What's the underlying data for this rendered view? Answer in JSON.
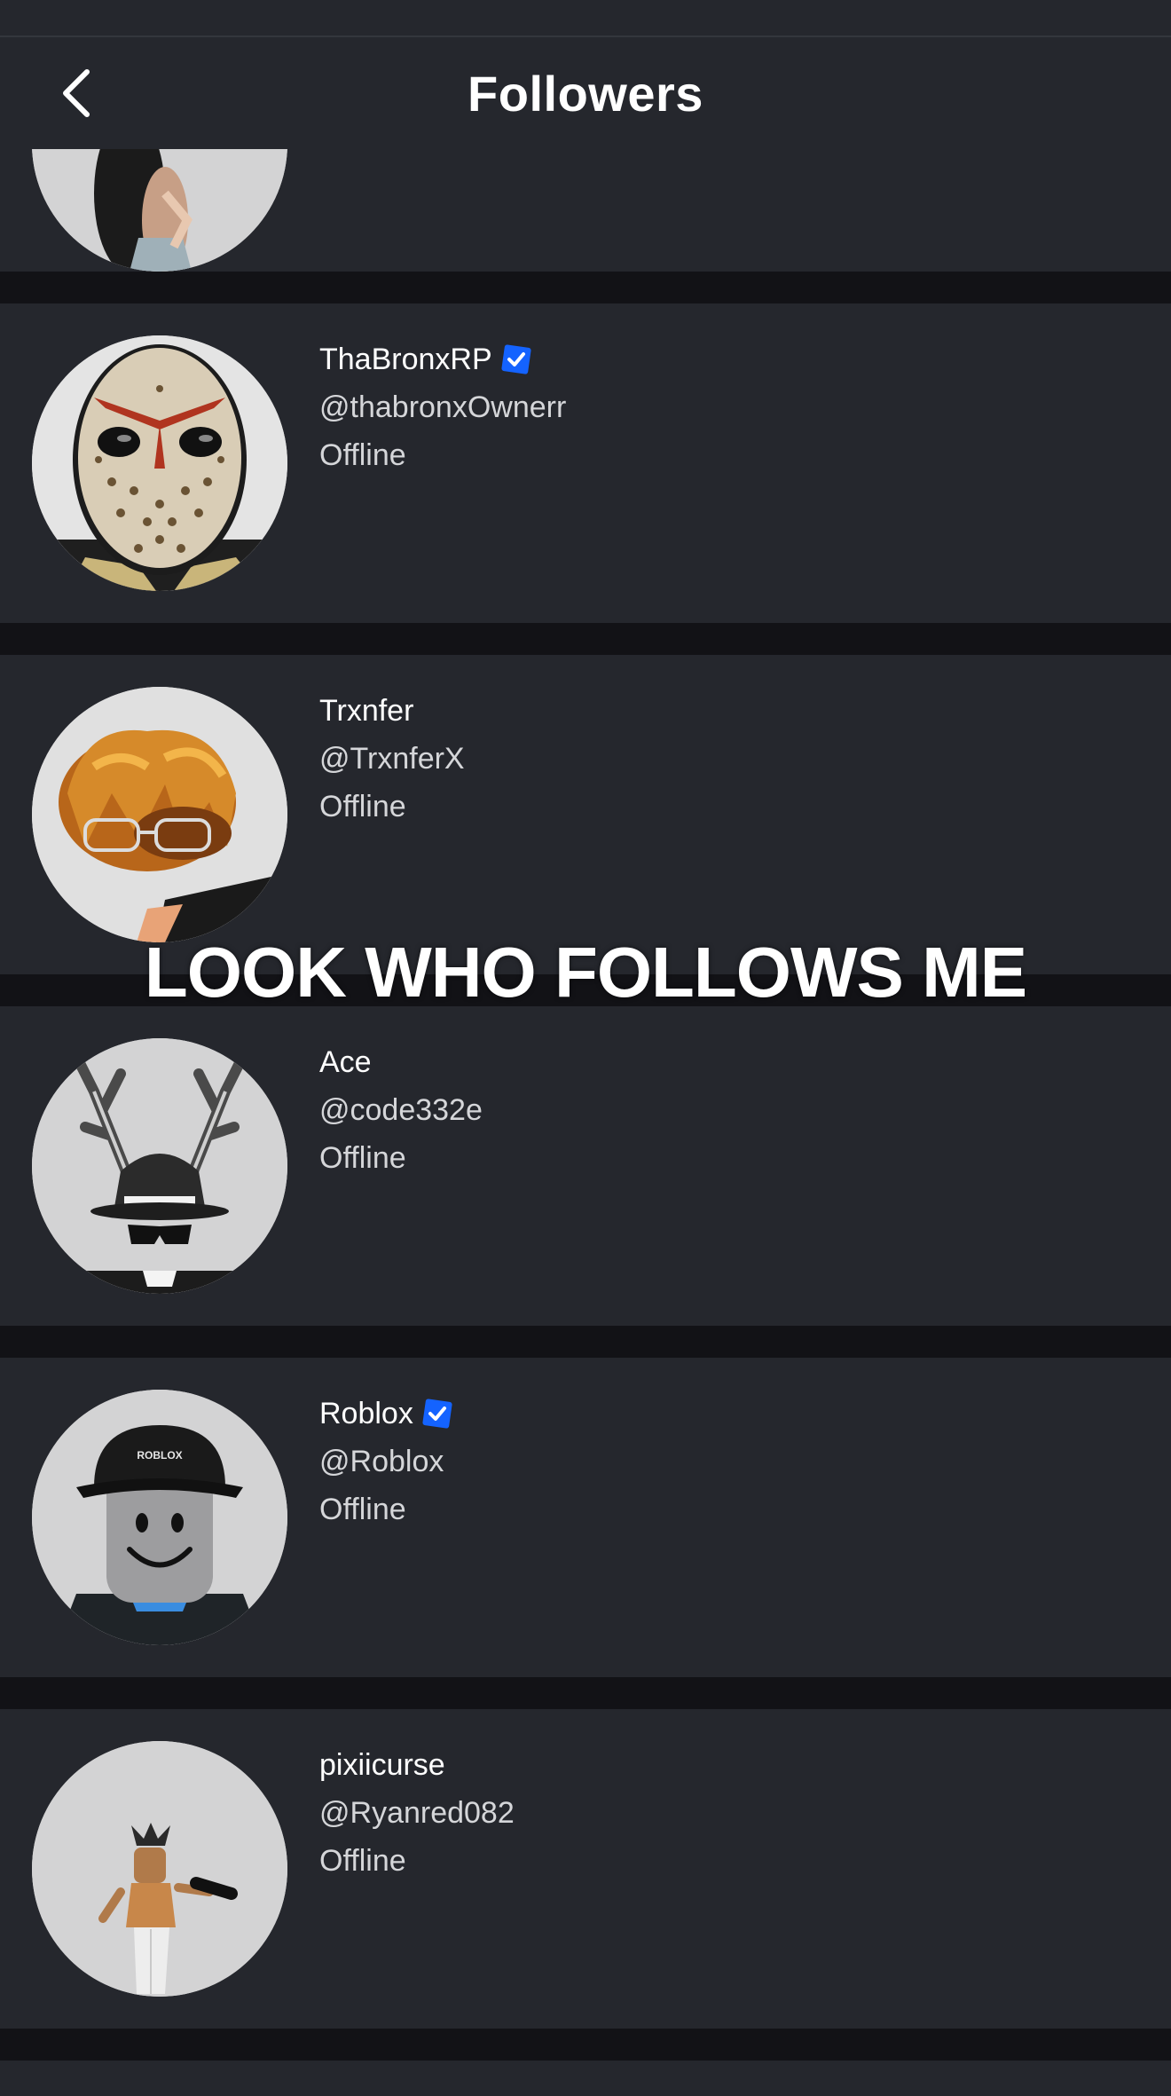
{
  "header": {
    "title": "Followers",
    "back_icon": "chevron-left-icon"
  },
  "overlay_text": "LOOK WHO FOLLOWS ME",
  "colors": {
    "card_bg": "#25272d",
    "divider": "#121216",
    "header_bg": "#25272d",
    "verified_badge": "#1463ff",
    "status_text": "#d5d6d9"
  },
  "followers": [
    {
      "display_name": "ThaBronxRP",
      "username": "@thabronxOwnerr",
      "status": "Offline",
      "verified": true,
      "avatar_icon": "hockey-mask-avatar"
    },
    {
      "display_name": "Trxnfer",
      "username": "@TrxnferX",
      "status": "Offline",
      "verified": false,
      "avatar_icon": "orange-hair-glasses-avatar"
    },
    {
      "display_name": "Ace",
      "username": "@code332e",
      "status": "Offline",
      "verified": false,
      "avatar_icon": "antlers-fedora-avatar"
    },
    {
      "display_name": "Roblox",
      "username": "@Roblox",
      "status": "Offline",
      "verified": true,
      "avatar_icon": "smiley-cap-avatar"
    },
    {
      "display_name": "pixiicurse",
      "username": "@Ryanred082",
      "status": "Offline",
      "verified": false,
      "avatar_icon": "small-character-avatar"
    }
  ]
}
